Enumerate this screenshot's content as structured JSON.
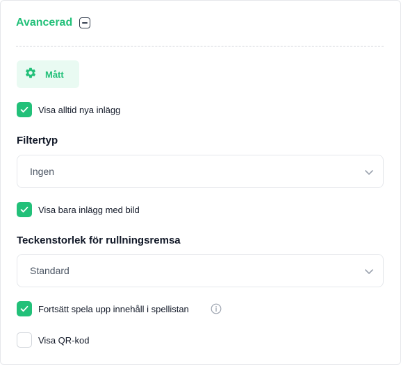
{
  "section": {
    "title": "Avancerad",
    "collapse_icon": "minus-square-icon",
    "accent_color": "#22c079"
  },
  "metrics_button": {
    "label": "Mått",
    "icon": "gear-icon"
  },
  "options": {
    "show_new_posts": {
      "label": "Visa alltid nya inlägg",
      "checked": true
    },
    "filter_type": {
      "label": "Filtertyp",
      "selected": "Ingen"
    },
    "show_image_posts": {
      "label": "Visa bara inlägg med bild",
      "checked": true
    },
    "font_size": {
      "label": "Teckenstorlek för rullningsremsa",
      "selected": "Standard"
    },
    "continue_playlist": {
      "label": "Fortsätt spela upp innehåll i spellistan",
      "checked": true,
      "info_icon": "info-icon"
    },
    "show_qr": {
      "label": "Visa QR-kod",
      "checked": false
    }
  }
}
